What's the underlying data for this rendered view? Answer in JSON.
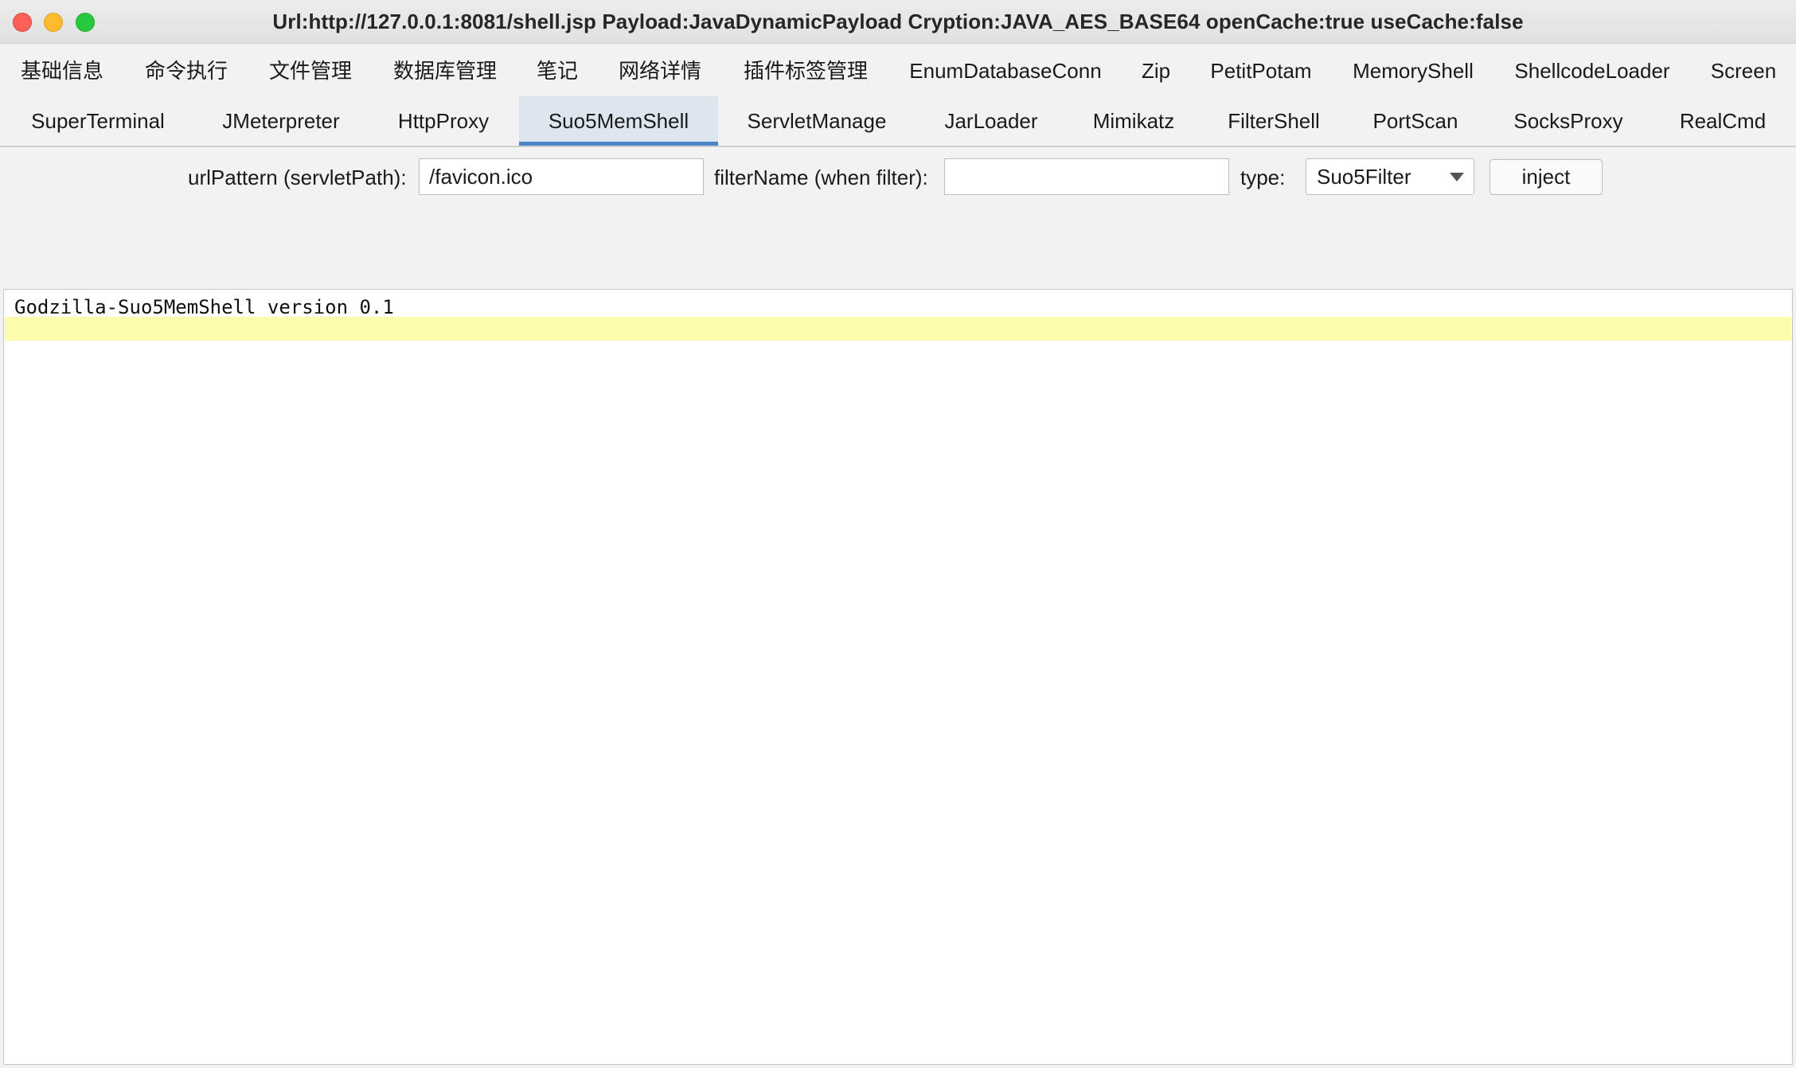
{
  "window": {
    "title": "Url:http://127.0.0.1:8081/shell.jsp Payload:JavaDynamicPayload Cryption:JAVA_AES_BASE64 openCache:true useCache:false"
  },
  "tabs": {
    "row1": [
      {
        "label": "基础信息"
      },
      {
        "label": "命令执行"
      },
      {
        "label": "文件管理"
      },
      {
        "label": "数据库管理"
      },
      {
        "label": "笔记"
      },
      {
        "label": "网络详情"
      },
      {
        "label": "插件标签管理"
      },
      {
        "label": "EnumDatabaseConn"
      },
      {
        "label": "Zip"
      },
      {
        "label": "PetitPotam"
      },
      {
        "label": "MemoryShell"
      },
      {
        "label": "ShellcodeLoader"
      },
      {
        "label": "Screen"
      }
    ],
    "row2": [
      {
        "label": "SuperTerminal"
      },
      {
        "label": "JMeterpreter"
      },
      {
        "label": "HttpProxy"
      },
      {
        "label": "Suo5MemShell"
      },
      {
        "label": "ServletManage"
      },
      {
        "label": "JarLoader"
      },
      {
        "label": "Mimikatz"
      },
      {
        "label": "FilterShell"
      },
      {
        "label": "PortScan"
      },
      {
        "label": "SocksProxy"
      },
      {
        "label": "RealCmd"
      }
    ],
    "selected": "Suo5MemShell"
  },
  "form": {
    "url_pattern_label": "urlPattern (servletPath):",
    "url_pattern_value": "/favicon.ico",
    "filter_name_label": "filterName (when filter):",
    "filter_name_value": "",
    "type_label": "type:",
    "type_value": "Suo5Filter",
    "inject_label": "inject"
  },
  "output": {
    "lines": [
      "Godzilla-Suo5MemShell version 0.1"
    ]
  },
  "colors": {
    "selected_tab_bg": "#dde6ef",
    "selected_tab_underline": "#4a86c5",
    "current_line_highlight": "#fcfcac"
  }
}
